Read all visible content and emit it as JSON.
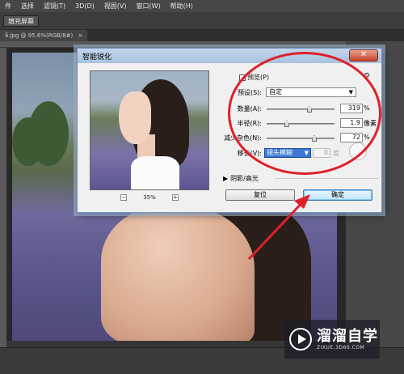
{
  "menubar": {
    "items": [
      "件",
      "选择",
      "滤镜(T)",
      "3D(D)",
      "视图(V)",
      "窗口(W)",
      "帮助(H)"
    ]
  },
  "options_bar": {
    "button_label": "填充屏幕"
  },
  "document_tab": {
    "label": "å.jpg @ 95.6%(RGB/8#)",
    "close": "×"
  },
  "dialog": {
    "title": "智能锐化",
    "close_symbol": "✕",
    "preview_checkbox_label": "预览(P)",
    "zoom_minus": "−",
    "zoom_plus": "+",
    "zoom_level": "35%",
    "preset_label": "预设(S):",
    "preset_value": "自定",
    "amount_label": "数量(A):",
    "amount_value": "319",
    "amount_unit": "%",
    "amount_fraction": 0.64,
    "radius_label": "半径(R):",
    "radius_value": "1.9",
    "radius_unit": "像素",
    "radius_fraction": 0.28,
    "noise_label": "减少杂色(N):",
    "noise_value": "72",
    "noise_unit": "%",
    "noise_fraction": 0.72,
    "remove_label": "移去(V):",
    "remove_value": "镜头模糊",
    "angle_value": "0",
    "angle_unit": "度",
    "shadow_section_label": "阴影/高光",
    "reset_button": "复位",
    "ok_button": "确定"
  },
  "watermark": {
    "title": "溜溜自学",
    "url": "ZIXUE.3D66.COM"
  },
  "colors": {
    "annotation": "#e0202a",
    "primary_button": "#bee6fd"
  }
}
